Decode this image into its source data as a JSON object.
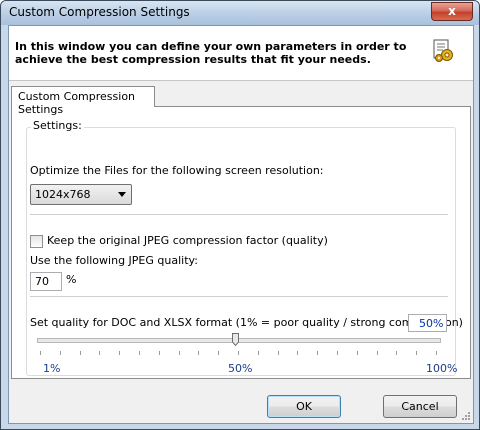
{
  "window": {
    "title": "Custom Compression Settings",
    "close_label": "x"
  },
  "header": {
    "text": "In this window you can define your own parameters in order to achieve the best compression results that fit your needs.",
    "icon": "gear-document-icon"
  },
  "tab": {
    "label": "Custom Compression Settings"
  },
  "settings": {
    "group_label": "Settings:",
    "resolution_label": "Optimize the Files for the following screen resolution:",
    "resolution_value": "1024x768",
    "keep_jpeg_label": "Keep the original JPEG compression factor (quality)",
    "keep_jpeg_checked": false,
    "jpeg_quality_label": "Use the following JPEG quality:",
    "jpeg_quality_value": "70",
    "jpeg_quality_unit": "%",
    "doc_quality_label": "Set quality for DOC and XLSX format (1% = poor quality / strong compression)",
    "doc_quality_value": "50%",
    "slider_position_percent": 50,
    "slider_min_label": "1%",
    "slider_mid_label": "50%",
    "slider_max_label": "100%"
  },
  "buttons": {
    "ok": "OK",
    "cancel": "Cancel"
  }
}
